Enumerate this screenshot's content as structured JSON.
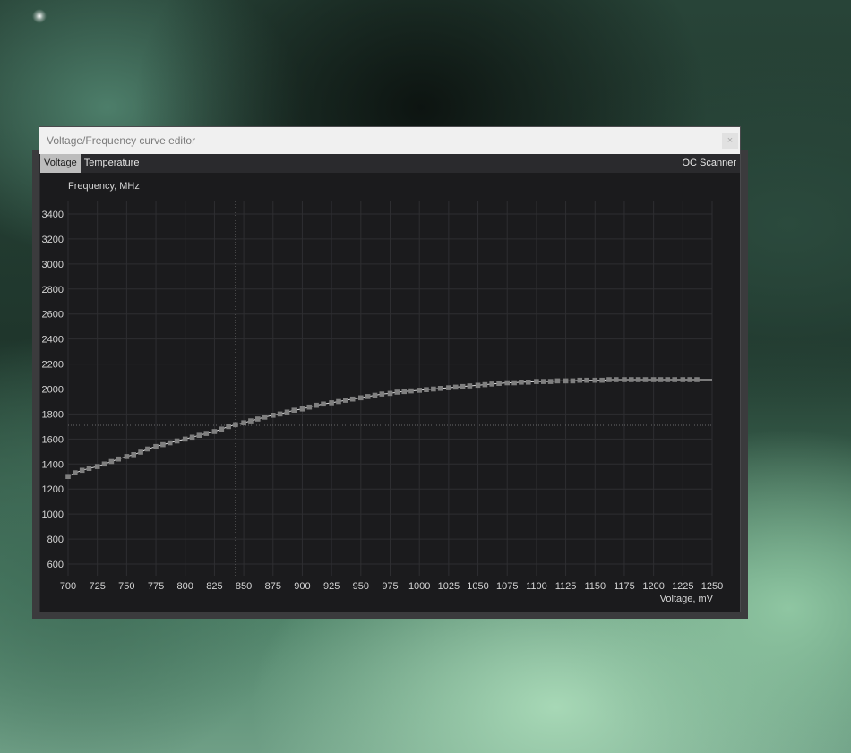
{
  "window": {
    "title": "Voltage/Frequency curve editor",
    "close_glyph": "×"
  },
  "tabs": [
    {
      "label": "Voltage",
      "active": true
    },
    {
      "label": "Temperature",
      "active": false
    }
  ],
  "oc_scanner_label": "OC Scanner",
  "colors": {
    "plot_background": "#1b1b1d",
    "curve_marker": "#7f7f7f",
    "curve_line": "#dcdcdc",
    "grid": "#2e2e31",
    "tab_active": "#bdbdbd"
  },
  "chart_data": {
    "type": "line",
    "ylabel": "Frequency, MHz",
    "xlabel": "Voltage, mV",
    "x_ticks": [
      700,
      725,
      750,
      775,
      800,
      825,
      850,
      875,
      900,
      925,
      950,
      975,
      1000,
      1025,
      1050,
      1075,
      1100,
      1125,
      1150,
      1175,
      1200,
      1225,
      1250
    ],
    "y_ticks": [
      600,
      800,
      1000,
      1200,
      1400,
      1600,
      1800,
      2000,
      2200,
      2400,
      2600,
      2800,
      3000,
      3200,
      3400
    ],
    "xlim": [
      700,
      1250
    ],
    "ylim": [
      500,
      3500
    ],
    "grid": true,
    "cursor": {
      "voltage": 843,
      "frequency": 1710
    },
    "series": [
      {
        "x": [
          700,
          706,
          712,
          718,
          725,
          731,
          737,
          743,
          750,
          756,
          762,
          768,
          775,
          781,
          787,
          793,
          800,
          806,
          812,
          818,
          825,
          831,
          837,
          843,
          850,
          856,
          862,
          868,
          875,
          881,
          887,
          893,
          900,
          906,
          912,
          918,
          925,
          931,
          937,
          943,
          950,
          956,
          962,
          968,
          975,
          981,
          987,
          993,
          1000,
          1006,
          1012,
          1018,
          1025,
          1031,
          1037,
          1043,
          1050,
          1056,
          1062,
          1068,
          1075,
          1081,
          1087,
          1093,
          1100,
          1106,
          1112,
          1118,
          1125,
          1131,
          1137,
          1143,
          1150,
          1156,
          1162,
          1168,
          1175,
          1181,
          1187,
          1193,
          1200,
          1206,
          1212,
          1218,
          1225,
          1231,
          1237
        ],
        "y": [
          1300,
          1330,
          1350,
          1365,
          1380,
          1400,
          1420,
          1440,
          1460,
          1475,
          1495,
          1520,
          1540,
          1555,
          1570,
          1585,
          1600,
          1615,
          1630,
          1645,
          1660,
          1680,
          1700,
          1715,
          1730,
          1745,
          1760,
          1775,
          1790,
          1800,
          1815,
          1830,
          1840,
          1855,
          1870,
          1880,
          1890,
          1900,
          1910,
          1920,
          1930,
          1940,
          1950,
          1960,
          1965,
          1975,
          1980,
          1985,
          1990,
          1995,
          2000,
          2005,
          2010,
          2015,
          2020,
          2025,
          2030,
          2035,
          2040,
          2045,
          2050,
          2050,
          2055,
          2055,
          2060,
          2060,
          2060,
          2065,
          2065,
          2065,
          2070,
          2070,
          2070,
          2070,
          2075,
          2075,
          2075,
          2075,
          2075,
          2075,
          2075,
          2075,
          2075,
          2075,
          2075,
          2075,
          2075
        ]
      }
    ]
  }
}
